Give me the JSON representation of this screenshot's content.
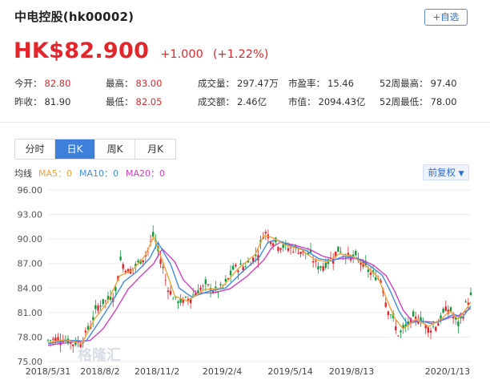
{
  "stock": {
    "title": "中电控股(hk00002)",
    "add_label": "+自选",
    "price": "HK$82.900",
    "change": "+1.000",
    "change_pct": "(+1.22%)"
  },
  "stats": [
    {
      "label": "今开：",
      "value": "82.80",
      "tone": "up"
    },
    {
      "label": "最高：",
      "value": "83.00",
      "tone": "up"
    },
    {
      "label": "成交量：",
      "value": "297.47万",
      "tone": "nt"
    },
    {
      "label": "市盈率：",
      "value": "15.46",
      "tone": "nt"
    },
    {
      "label": "52周最高：",
      "value": "97.40",
      "tone": "nt"
    },
    {
      "label": "昨收：",
      "value": "81.90",
      "tone": "nt"
    },
    {
      "label": "最低：",
      "value": "82.05",
      "tone": "up"
    },
    {
      "label": "成交额：",
      "value": "2.46亿",
      "tone": "nt"
    },
    {
      "label": "市值：",
      "value": "2094.43亿",
      "tone": "nt"
    },
    {
      "label": "52周最低：",
      "value": "78.00",
      "tone": "nt"
    }
  ],
  "tabs": [
    {
      "label": "分时",
      "active": false
    },
    {
      "label": "日K",
      "active": true
    },
    {
      "label": "周K",
      "active": false
    },
    {
      "label": "月K",
      "active": false
    }
  ],
  "ma": {
    "label": "均线",
    "ma5": "MA5：0",
    "ma10": "MA10：0",
    "ma20": "MA20：0",
    "colors": {
      "ma5": "#f2a23a",
      "ma10": "#3f8ee0",
      "ma20": "#d53fc3"
    }
  },
  "adjust_label": "前复权",
  "colors": {
    "up": "#e3262b",
    "down": "#109b3c",
    "accent": "#3d7fd9"
  },
  "chart_data": {
    "type": "candlestick",
    "ylim": [
      75.0,
      96.0
    ],
    "yticks": [
      "96.00",
      "93.00",
      "90.00",
      "87.00",
      "84.00",
      "81.00",
      "78.00",
      "75.00"
    ],
    "xticks": [
      "2018/5/31",
      "2018/8/2",
      "2018/11/2",
      "2019/2/4",
      "2019/5/14",
      "2019/8/13",
      "2020/1/13"
    ],
    "watermark": "格隆汇",
    "close_path": [
      [
        0,
        77.6
      ],
      [
        3,
        77.9
      ],
      [
        6,
        77.2
      ],
      [
        8,
        77.5
      ],
      [
        10,
        79.5
      ],
      [
        12,
        82.0
      ],
      [
        14,
        82.5
      ],
      [
        16,
        83.5
      ],
      [
        17,
        87.5
      ],
      [
        19,
        86.0
      ],
      [
        21,
        86.8
      ],
      [
        23,
        88.0
      ],
      [
        25,
        90.5
      ],
      [
        26,
        88.5
      ],
      [
        27,
        87.0
      ],
      [
        28,
        84.5
      ],
      [
        30,
        82.5
      ],
      [
        32,
        82.3
      ],
      [
        34,
        83.0
      ],
      [
        36,
        84.0
      ],
      [
        38,
        84.2
      ],
      [
        40,
        83.5
      ],
      [
        42,
        84.5
      ],
      [
        44,
        86.5
      ],
      [
        46,
        86.6
      ],
      [
        48,
        87.3
      ],
      [
        50,
        88.5
      ],
      [
        51,
        91.0
      ],
      [
        52,
        90.5
      ],
      [
        54,
        89.5
      ],
      [
        56,
        89.0
      ],
      [
        58,
        88.8
      ],
      [
        60,
        88.5
      ],
      [
        62,
        88.0
      ],
      [
        64,
        86.5
      ],
      [
        66,
        87.0
      ],
      [
        68,
        88.3
      ],
      [
        69,
        88.8
      ],
      [
        70,
        88.0
      ],
      [
        72,
        87.8
      ],
      [
        74,
        87.3
      ],
      [
        75,
        86.5
      ],
      [
        77,
        85.5
      ],
      [
        79,
        85.0
      ],
      [
        80,
        82.0
      ],
      [
        81,
        81.0
      ],
      [
        82,
        79.5
      ],
      [
        83,
        78.2
      ],
      [
        84,
        78.8
      ],
      [
        86,
        80.0
      ],
      [
        88,
        80.5
      ],
      [
        89,
        79.5
      ],
      [
        90,
        79.0
      ],
      [
        92,
        79.5
      ],
      [
        94,
        81.3
      ],
      [
        95,
        81.5
      ],
      [
        96,
        80.2
      ],
      [
        97,
        79.5
      ],
      [
        98,
        80.5
      ],
      [
        99,
        82.3
      ],
      [
        100,
        82.9
      ]
    ],
    "ma5_path": [
      [
        0,
        77.3
      ],
      [
        4,
        77.7
      ],
      [
        8,
        77.2
      ],
      [
        11,
        80.2
      ],
      [
        14,
        82.2
      ],
      [
        17,
        85.5
      ],
      [
        20,
        86.2
      ],
      [
        23,
        88.0
      ],
      [
        25,
        90.3
      ],
      [
        28,
        86.0
      ],
      [
        30,
        83.0
      ],
      [
        33,
        82.4
      ],
      [
        37,
        83.8
      ],
      [
        41,
        84.0
      ],
      [
        45,
        86.4
      ],
      [
        49,
        88.1
      ],
      [
        51,
        90.4
      ],
      [
        53,
        90.2
      ],
      [
        56,
        89.3
      ],
      [
        60,
        88.7
      ],
      [
        63,
        87.5
      ],
      [
        66,
        87.2
      ],
      [
        69,
        88.2
      ],
      [
        72,
        87.9
      ],
      [
        75,
        86.8
      ],
      [
        78,
        85.4
      ],
      [
        80,
        82.8
      ],
      [
        82,
        80.3
      ],
      [
        84,
        79.0
      ],
      [
        87,
        80.2
      ],
      [
        90,
        79.3
      ],
      [
        93,
        80.2
      ],
      [
        95,
        81.2
      ],
      [
        97,
        80.2
      ],
      [
        99,
        81.5
      ],
      [
        100,
        82.3
      ]
    ],
    "ma10_path": [
      [
        0,
        77.2
      ],
      [
        5,
        77.6
      ],
      [
        9,
        77.5
      ],
      [
        12,
        79.8
      ],
      [
        15,
        82.2
      ],
      [
        18,
        84.8
      ],
      [
        21,
        86.0
      ],
      [
        24,
        87.6
      ],
      [
        26,
        89.6
      ],
      [
        29,
        86.9
      ],
      [
        31,
        84.0
      ],
      [
        34,
        82.9
      ],
      [
        38,
        83.6
      ],
      [
        42,
        84.0
      ],
      [
        46,
        86.0
      ],
      [
        50,
        87.8
      ],
      [
        52,
        89.6
      ],
      [
        54,
        89.9
      ],
      [
        57,
        89.3
      ],
      [
        61,
        88.6
      ],
      [
        64,
        87.6
      ],
      [
        67,
        87.3
      ],
      [
        70,
        87.9
      ],
      [
        73,
        87.7
      ],
      [
        76,
        86.8
      ],
      [
        79,
        85.6
      ],
      [
        81,
        83.6
      ],
      [
        83,
        81.2
      ],
      [
        85,
        79.6
      ],
      [
        88,
        80.0
      ],
      [
        91,
        79.6
      ],
      [
        94,
        80.3
      ],
      [
        96,
        80.8
      ],
      [
        98,
        80.4
      ],
      [
        100,
        81.8
      ]
    ],
    "ma20_path": [
      [
        0,
        77.0
      ],
      [
        6,
        77.4
      ],
      [
        10,
        77.6
      ],
      [
        13,
        79.0
      ],
      [
        16,
        81.3
      ],
      [
        19,
        83.9
      ],
      [
        22,
        85.5
      ],
      [
        25,
        87.0
      ],
      [
        27,
        88.8
      ],
      [
        30,
        87.2
      ],
      [
        32,
        85.0
      ],
      [
        35,
        83.4
      ],
      [
        39,
        83.4
      ],
      [
        43,
        83.9
      ],
      [
        47,
        85.4
      ],
      [
        51,
        87.4
      ],
      [
        53,
        89.0
      ],
      [
        55,
        89.6
      ],
      [
        58,
        89.3
      ],
      [
        62,
        88.7
      ],
      [
        65,
        87.9
      ],
      [
        68,
        87.5
      ],
      [
        71,
        87.7
      ],
      [
        74,
        87.5
      ],
      [
        77,
        86.8
      ],
      [
        80,
        85.5
      ],
      [
        82,
        83.6
      ],
      [
        84,
        81.3
      ],
      [
        86,
        80.0
      ],
      [
        89,
        79.9
      ],
      [
        92,
        79.8
      ],
      [
        95,
        80.4
      ],
      [
        97,
        80.6
      ],
      [
        100,
        81.5
      ]
    ]
  }
}
